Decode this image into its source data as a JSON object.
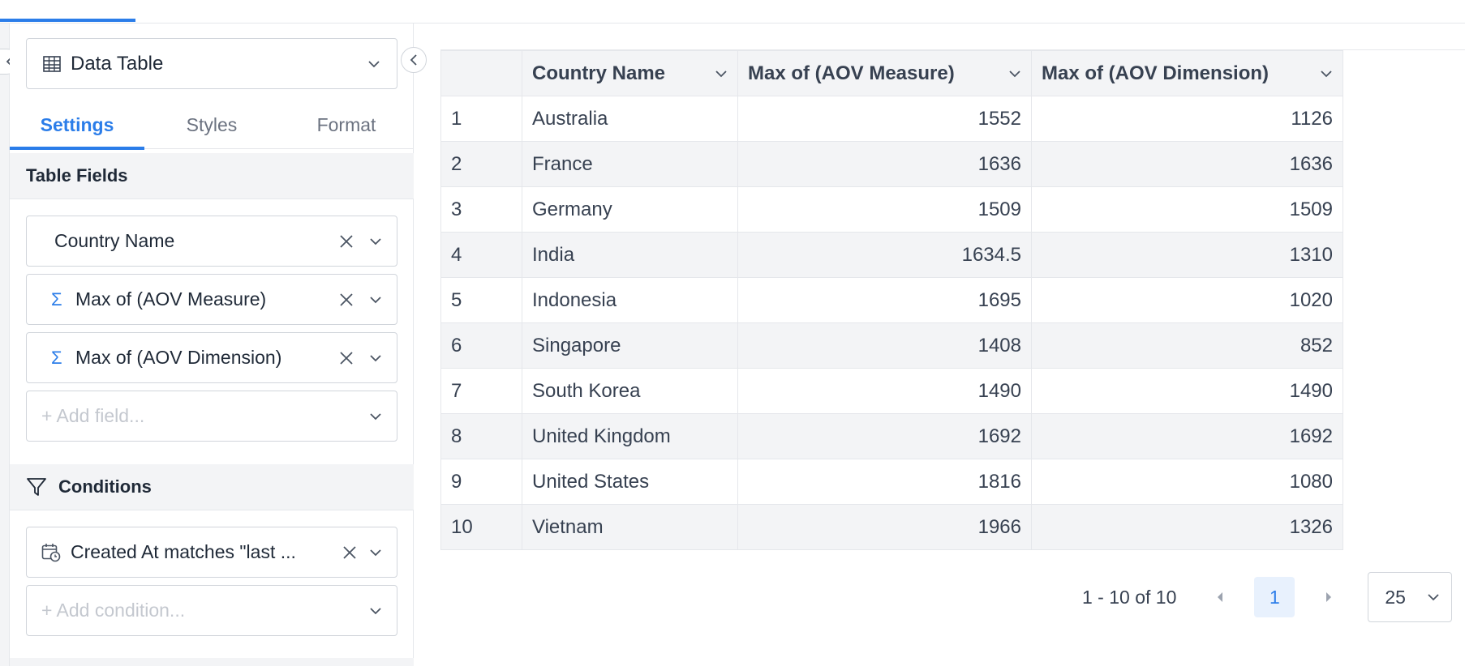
{
  "panel": {
    "viz_label": "Data Table",
    "tabs": [
      {
        "label": "Settings"
      },
      {
        "label": "Styles"
      },
      {
        "label": "Format"
      }
    ],
    "table_fields_title": "Table Fields",
    "fields": [
      {
        "label": "Country Name",
        "aggregate": false
      },
      {
        "label": "Max of (AOV Measure)",
        "aggregate": true
      },
      {
        "label": "Max of (AOV Dimension)",
        "aggregate": true
      }
    ],
    "add_field_placeholder": "+ Add field...",
    "conditions_title": "Conditions",
    "condition": "Created At matches \"last ...",
    "add_condition_placeholder": "+ Add condition..."
  },
  "table": {
    "columns": [
      "",
      "Country Name",
      "Max of (AOV Measure)",
      "Max of (AOV Dimension)"
    ],
    "rows": [
      [
        "1",
        "Australia",
        "1552",
        "1126"
      ],
      [
        "2",
        "France",
        "1636",
        "1636"
      ],
      [
        "3",
        "Germany",
        "1509",
        "1509"
      ],
      [
        "4",
        "India",
        "1634.5",
        "1310"
      ],
      [
        "5",
        "Indonesia",
        "1695",
        "1020"
      ],
      [
        "6",
        "Singapore",
        "1408",
        "852"
      ],
      [
        "7",
        "South Korea",
        "1490",
        "1490"
      ],
      [
        "8",
        "United Kingdom",
        "1692",
        "1692"
      ],
      [
        "9",
        "United States",
        "1816",
        "1080"
      ],
      [
        "10",
        "Vietnam",
        "1966",
        "1326"
      ]
    ]
  },
  "pager": {
    "range": "1 - 10 of 10",
    "current_page": "1",
    "page_size": "25"
  },
  "colors": {
    "accent": "#2b7de9",
    "row_alt": "#f3f4f6",
    "border": "#e5e7eb"
  }
}
